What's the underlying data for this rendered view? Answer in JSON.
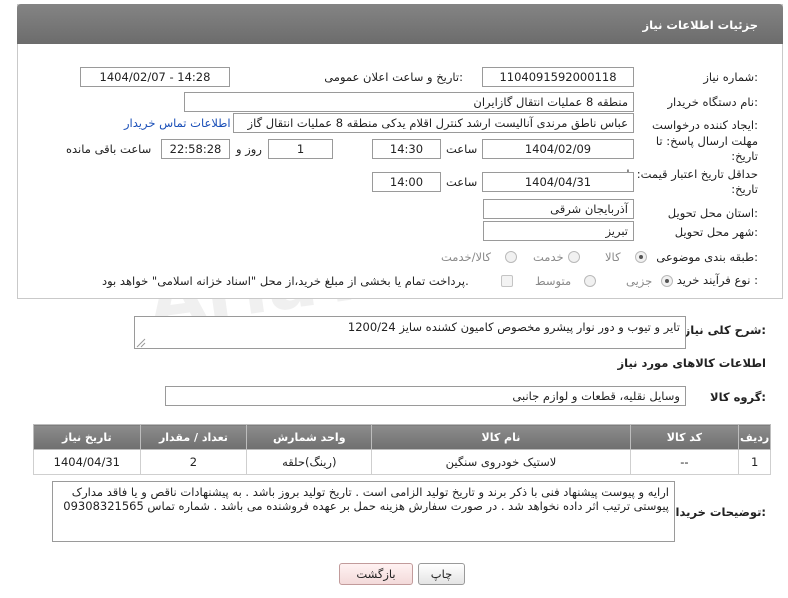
{
  "panel": {
    "title": "جزئیات اطلاعات نیاز"
  },
  "labels": {
    "need_number": "شماره نیاز:",
    "announce_datetime": "تاریخ و ساعت اعلان عمومی:",
    "buyer_org": "نام دستگاه خریدار:",
    "requester": "ایجاد کننده درخواست:",
    "reply_deadline": "مهلت ارسال پاسخ: تا تاریخ:",
    "price_validity": "حداقل تاریخ اعتبار قیمت: تا تاریخ:",
    "time": "ساعت",
    "day_and": "روز و",
    "hours_left": "ساعت باقی مانده",
    "delivery_province": "استان محل تحویل:",
    "delivery_city": "شهر محل تحویل:",
    "category": "طبقه بندی موضوعی:",
    "purchase_type": "نوع فرآیند خرید :",
    "general_desc": "شرح کلی نیاز:",
    "goods_info": "اطلاعات کالاهای مورد نیاز",
    "goods_group": "گروه کالا:",
    "buyer_notes": "توضیحات خریدار:"
  },
  "fields": {
    "need_number": "1104091592000118",
    "announce_datetime": "1404/02/07 - 14:28",
    "buyer_org": "منطقه 8 عملیات انتقال گازایران",
    "requester": "عباس ناطق مرندی آنالیست ارشد کنترل اقلام یدکی منطقه 8 عملیات انتقال گاز",
    "buyer_contact_link": "اطلاعات تماس خریدار",
    "reply_date": "1404/02/09",
    "reply_time": "14:30",
    "reply_days": "1",
    "reply_remaining": "22:58:28",
    "validity_date": "1404/04/31",
    "validity_time": "14:00",
    "province": "آذربایجان شرقی",
    "city": "تبریز",
    "general_desc": "تایر و تیوب و دور نوار پیشرو مخصوص کامیون کشنده سایز 1200/24",
    "goods_group": "وسایل نقلیه، قطعات و لوازم جانبی",
    "buyer_notes": "ارایه و پیوست پیشنهاد فنی با ذکر برند و تاریخ تولید الزامی است . تاریخ تولید بروز باشد . به پیشنهادات ناقص و یا فاقد مدارک پیوستی ترتیب اثر داده نخواهد شد . در صورت سفارش هزینه حمل بر عهده فروشنده می باشد . شماره تماس 09308321565"
  },
  "category_options": {
    "goods": "کالا",
    "service": "خدمت",
    "goods_service": "کالا/خدمت",
    "selected": "goods"
  },
  "purchase_options": {
    "minor": "جزیی",
    "medium": "متوسط",
    "selected": "minor",
    "treasury_note": "پرداخت تمام یا بخشی از مبلغ خرید،از محل \"اسناد خزانه اسلامی\" خواهد بود."
  },
  "table": {
    "headers": [
      "ردیف",
      "کد کالا",
      "نام کالا",
      "واحد شمارش",
      "تعداد / مقدار",
      "تاریخ نیاز"
    ],
    "rows": [
      [
        "1",
        "--",
        "لاستیک خودروی سنگین",
        "(رینگ)حلقه",
        "2",
        "1404/04/31"
      ]
    ]
  },
  "buttons": {
    "print": "چاپ",
    "back": "بازگشت"
  },
  "watermark": "AriaTender.neT"
}
